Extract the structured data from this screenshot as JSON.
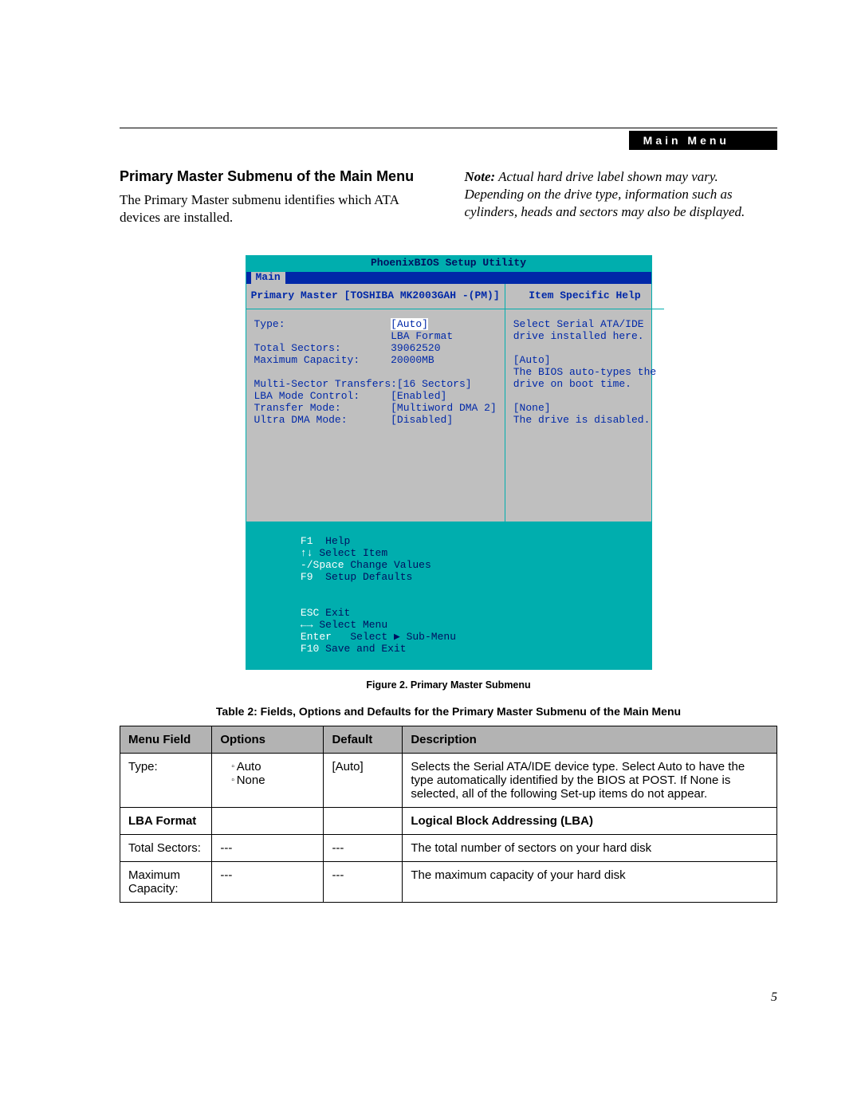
{
  "header": {
    "tab": "Main Menu"
  },
  "section": {
    "title": "Primary Master Submenu of the Main Menu",
    "intro": "The Primary Master submenu identifies which ATA devices are installed.",
    "note_label": "Note:",
    "note_body": " Actual hard drive label shown may vary. Depending on the drive type, information such as cylinders, heads and sectors may also be displayed."
  },
  "bios": {
    "title": "PhoenixBIOS Setup Utility",
    "tab": "Main",
    "left_header": "Primary Master [TOSHIBA MK2003GAH -(PM)]",
    "right_header": "Item Specific Help",
    "rows": [
      {
        "label": "Type:",
        "value": "[Auto]",
        "highlight": true
      },
      {
        "label": "",
        "value": "LBA Format"
      },
      {
        "label": "Total Sectors:",
        "value": "39062520"
      },
      {
        "label": "Maximum Capacity:",
        "value": "20000MB"
      },
      {
        "label": "",
        "value": ""
      },
      {
        "label": "Multi-Sector Transfers:",
        "value": "[16 Sectors]"
      },
      {
        "label": "LBA Mode Control:",
        "value": "[Enabled]"
      },
      {
        "label": "Transfer Mode:",
        "value": "[Multiword DMA 2]"
      },
      {
        "label": "Ultra DMA Mode:",
        "value": "[Disabled]"
      }
    ],
    "help": [
      "Select Serial ATA/IDE",
      "drive installed here.",
      "",
      "[Auto]",
      "The BIOS auto-types the",
      "drive on boot time.",
      "",
      "[None]",
      "The drive is disabled."
    ],
    "footer": {
      "f1": "F1",
      "help": "Help",
      "arrows1": "↑↓",
      "sel_item": "Select Item",
      "pm": "-/Space",
      "chg": "Change Values",
      "f9": "F9",
      "defaults": "Setup Defaults",
      "esc": "ESC",
      "exit": "Exit",
      "arrows2": "←→",
      "sel_menu": "Select Menu",
      "enter": "Enter",
      "sub": "Select ▶ Sub-Menu",
      "f10": "F10",
      "save": "Save and Exit"
    }
  },
  "figure_caption": "Figure 2.  Primary Master Submenu",
  "table_title": "Table 2: Fields, Options and Defaults for the Primary Master Submenu of the Main Menu",
  "table": {
    "head": [
      "Menu Field",
      "Options",
      "Default",
      "Description"
    ],
    "rows": [
      {
        "field": "Type:",
        "options": [
          "Auto",
          "None"
        ],
        "default": "[Auto]",
        "desc": "Selects the Serial ATA/IDE device type. Select Auto to have the type automatically identified by the BIOS at POST. If None is selected, all of the following Set-up items do not appear."
      }
    ],
    "lba": {
      "left": "LBA Format",
      "right": "Logical Block Addressing (LBA)"
    },
    "rows2": [
      {
        "field": "Total Sectors:",
        "options": "---",
        "default": "---",
        "desc": "The total number of sectors on your hard disk"
      },
      {
        "field": "Maximum Capacity:",
        "options": "---",
        "default": "---",
        "desc": "The maximum capacity of your hard disk"
      }
    ]
  },
  "page_number": "5"
}
